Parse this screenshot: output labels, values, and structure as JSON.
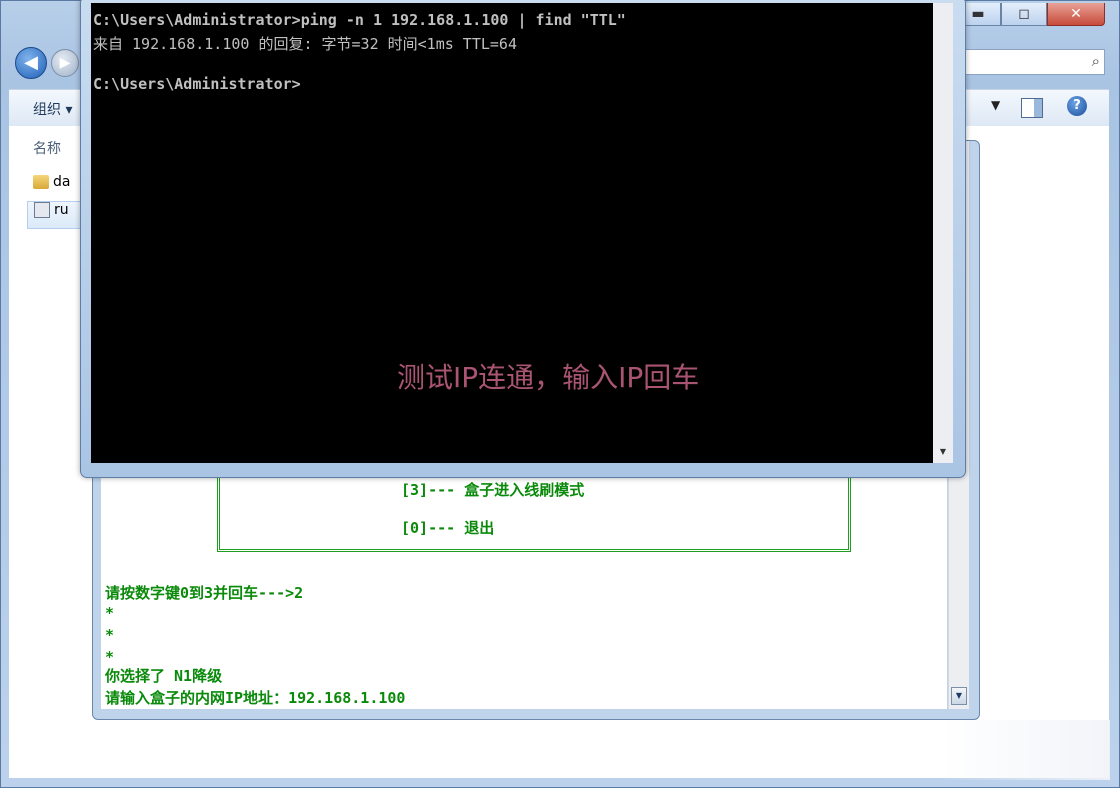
{
  "explorer": {
    "caption": {
      "minimize": "▬",
      "maximize": "◻",
      "close": "✕"
    },
    "toolbar": {
      "organize": "组织 ▾"
    },
    "column_header": "名称",
    "files": [
      {
        "name": "da",
        "type": "folder"
      },
      {
        "name": "ru",
        "type": "batch"
      }
    ]
  },
  "cmd": {
    "lines": [
      "C:\\Users\\Administrator>ping -n 1 192.168.1.100 | find \"TTL\"",
      "来自 192.168.1.100 的回复: 字节=32 时间<1ms TTL=64",
      "",
      "C:\\Users\\Administrator>"
    ],
    "overlay_note": "测试IP连通，输入IP回车"
  },
  "script_console": {
    "menu_items": [
      "[3]--- 盒子进入线刷模式",
      "[0]--- 退出"
    ],
    "prompt": "请按数字键0到3并回车--->2",
    "stars": [
      "*",
      "*",
      "*"
    ],
    "selection": "你选择了 N1降级",
    "ip_prompt": "请输入盒子的内网IP地址：192.168.1.100"
  },
  "colors": {
    "console_green": "#0a8a0a",
    "note_color": "#a95472",
    "cmd_bg": "#000000"
  }
}
